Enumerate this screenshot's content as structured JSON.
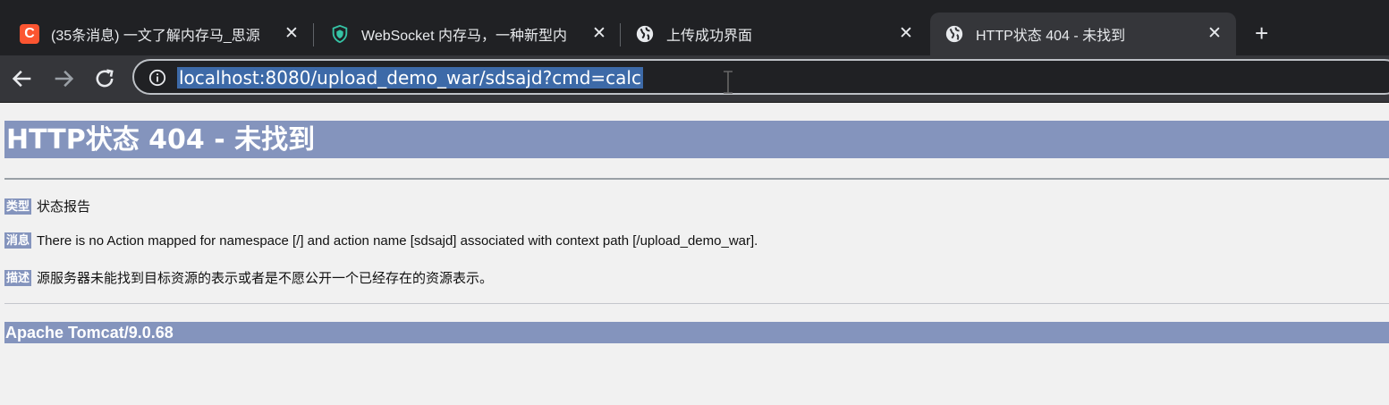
{
  "tabs": [
    {
      "title": "(35条消息) 一文了解内存马_思源",
      "favicon": "csdn-c-icon",
      "favicon_letter": "C",
      "active": false
    },
    {
      "title": "WebSocket 内存马，一种新型内",
      "favicon": "shield-icon",
      "active": false
    },
    {
      "title": "上传成功界面",
      "favicon": "globe-icon",
      "active": false
    },
    {
      "title": "HTTP状态 404 - 未找到",
      "favicon": "globe-icon",
      "active": true
    }
  ],
  "tab_close_glyph": "✕",
  "new_tab_glyph": "+",
  "address_bar": {
    "url": "localhost:8080/upload_demo_war/sdsajd?cmd=calc"
  },
  "page": {
    "heading": "HTTP状态 404 - 未找到",
    "rows": [
      {
        "label": "类型",
        "text": "状态报告"
      },
      {
        "label": "消息",
        "text": "There is no Action mapped for namespace [/] and action name [sdsajd] associated with context path [/upload_demo_war]."
      },
      {
        "label": "描述",
        "text": "源服务器未能找到目标资源的表示或者是不愿公开一个已经存在的资源表示。"
      }
    ],
    "footer": "Apache Tomcat/9.0.68"
  },
  "colors": {
    "tomcat_bar": "#8494bd",
    "tab_strip": "#202124",
    "active_tab": "#35363a",
    "url_selection": "#3d6aa8"
  }
}
